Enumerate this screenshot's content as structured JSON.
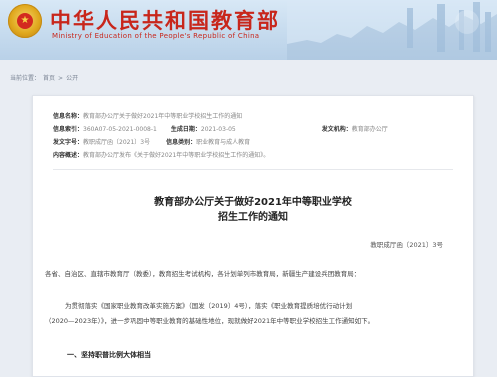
{
  "header": {
    "title": "中华人民共和国教育部",
    "subtitle": "Ministry of Education of the People's Republic of China"
  },
  "breadcrumb": {
    "prefix": "当前位置：",
    "home": "首页",
    "sep": ">",
    "current": "公开"
  },
  "meta": {
    "index_key": "信息名称：",
    "index_val": "教育部办公厅关于做好2021年中等职业学校招生工作的通知",
    "code_key": "信息索引：",
    "code_val": "360A07-05-2021-0008-1",
    "date_key": "生成日期：",
    "date_val": "2021-03-05",
    "org_key": "发文机构：",
    "org_val": "教育部办公厅",
    "doc_key": "发文字号：",
    "doc_val": "教职成厅函〔2021〕3号",
    "cat_key": "信息类别：",
    "cat_val": "职业教育与成人教育",
    "content_key": "内容概述：",
    "content_val": "教育部办公厅发布《关于做好2021年中等职业学校招生工作的通知》。"
  },
  "document": {
    "title_line1": "教育部办公厅关于做好2021年中等职业学校",
    "title_line2": "招生工作的通知",
    "number": "教职成厅函〔2021〕3号",
    "addressee": "各省、自治区、直辖市教育厅（教委），教育招生考试机构，各计划单列市教育局，新疆生产建设兵团教育局：",
    "para_line1": "为贯彻落实《国家职业教育改革实施方案》（国发〔2019〕4号），落实《职业教育提质培优行动计划",
    "para_line2": "（2020—2023年）》，进一步巩固中等职业教育的基础性地位，现就做好2021年中等职业学校招生工作通知如下。",
    "section1": "一、坚持职普比例大体相当"
  },
  "colors": {
    "brand_red": "#c8261b",
    "header_bg": "#c6dbee",
    "page_bg": "#e9edf3"
  }
}
